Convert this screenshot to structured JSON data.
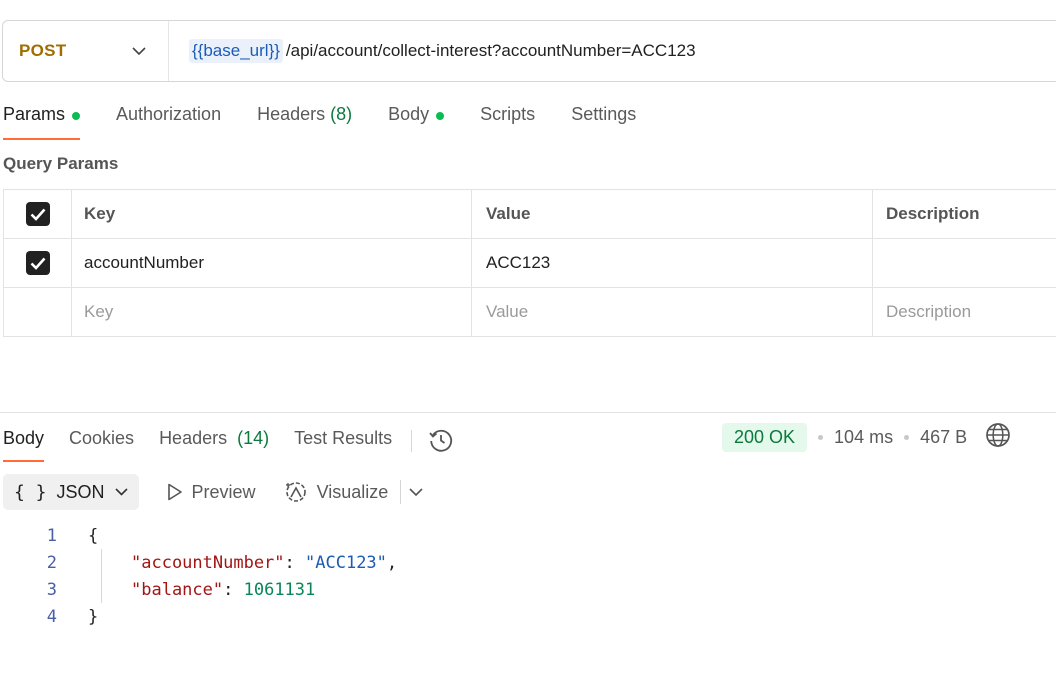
{
  "request": {
    "method": "POST",
    "url_variable": "{{base_url}}",
    "url_path": "/api/account/collect-interest?accountNumber=ACC123"
  },
  "tabs": [
    {
      "label": "Params",
      "dot": true
    },
    {
      "label": "Authorization"
    },
    {
      "label": "Headers",
      "count": "(8)"
    },
    {
      "label": "Body",
      "dot": true
    },
    {
      "label": "Scripts"
    },
    {
      "label": "Settings"
    }
  ],
  "query_params": {
    "title": "Query Params",
    "headers": {
      "key": "Key",
      "value": "Value",
      "description": "Description"
    },
    "rows": [
      {
        "checked": true,
        "key": "accountNumber",
        "value": "ACC123",
        "description": ""
      }
    ],
    "placeholders": {
      "key": "Key",
      "value": "Value",
      "description": "Description"
    }
  },
  "response": {
    "tabs": [
      {
        "label": "Body"
      },
      {
        "label": "Cookies"
      },
      {
        "label": "Headers",
        "count": "(14)"
      },
      {
        "label": "Test Results"
      }
    ],
    "status": "200 OK",
    "time": "104 ms",
    "size": "467 B",
    "format": "JSON",
    "tools": {
      "preview": "Preview",
      "visualize": "Visualize"
    },
    "body_lines": [
      {
        "n": "1",
        "text": "{"
      },
      {
        "n": "2",
        "key": "\"accountNumber\"",
        "sep": ": ",
        "value": "\"ACC123\"",
        "trail": ","
      },
      {
        "n": "3",
        "key": "\"balance\"",
        "sep": ": ",
        "value": "1061131",
        "trail": ""
      },
      {
        "n": "4",
        "text": "}"
      }
    ]
  },
  "colors": {
    "method": "#a06d00",
    "accent_tab": "#ff6c37",
    "status_ok_bg": "#e4f8ec",
    "status_ok_text": "#0a7a3e",
    "dot_green": "#0cbb52"
  }
}
